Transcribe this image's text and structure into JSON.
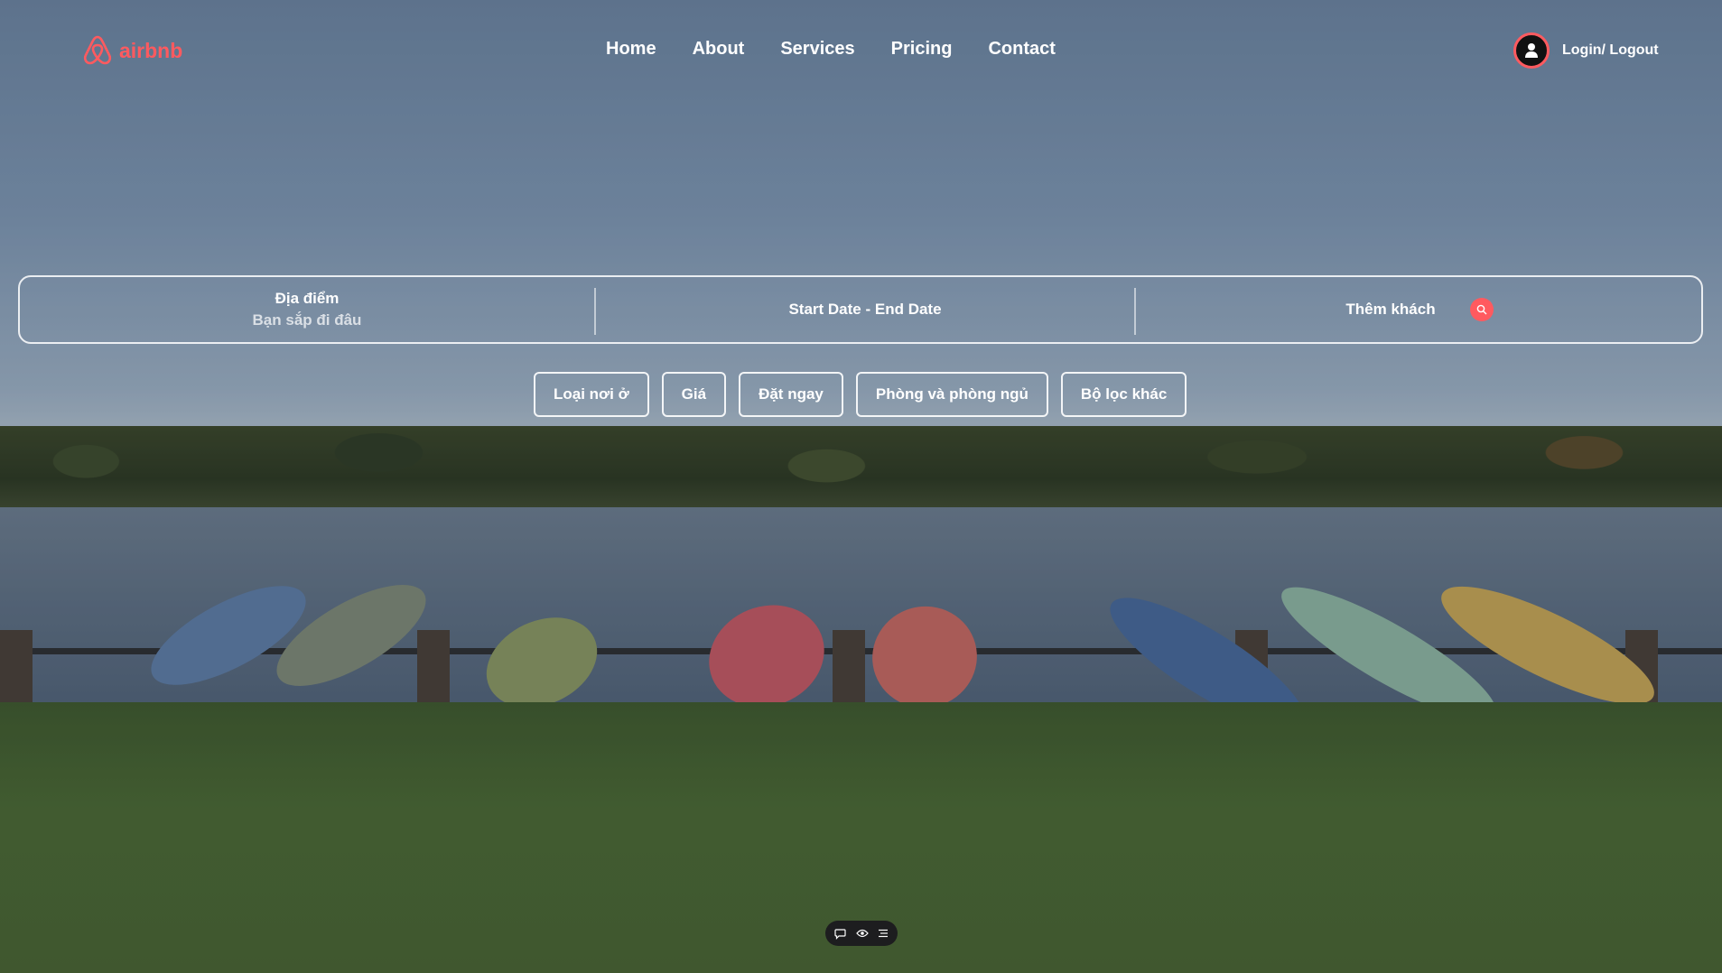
{
  "brand": {
    "name": "airbnb",
    "color": "#ff5a5f",
    "icon": "airbnb-logo-icon"
  },
  "nav": {
    "items": [
      {
        "label": "Home"
      },
      {
        "label": "About"
      },
      {
        "label": "Services"
      },
      {
        "label": "Pricing"
      },
      {
        "label": "Contact"
      }
    ]
  },
  "account": {
    "label": "Login/ Logout",
    "icon": "user-icon"
  },
  "search": {
    "location_label": "Địa điểm",
    "location_placeholder": "Bạn sắp đi đâu",
    "dates_label": "Start Date - End Date",
    "guests_label": "Thêm khách",
    "button_icon": "search-icon"
  },
  "filters": [
    {
      "label": "Loại nơi ở"
    },
    {
      "label": "Giá"
    },
    {
      "label": "Đặt ngay"
    },
    {
      "label": "Phòng và phòng ngủ"
    },
    {
      "label": "Bộ lọc khác"
    }
  ],
  "toolbar": {
    "icons": [
      "comment-icon",
      "eye-icon",
      "list-icon"
    ]
  }
}
